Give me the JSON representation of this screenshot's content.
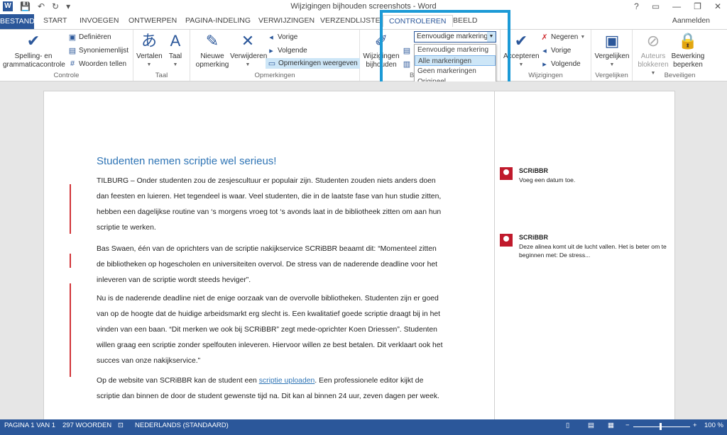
{
  "window": {
    "title": "Wijzigingen bijhouden screenshots - Word",
    "controls": [
      "?",
      "▭",
      "—",
      "❐",
      "✕"
    ]
  },
  "quick_access": [
    "save-icon",
    "undo-icon",
    "redo-icon",
    "customize-icon"
  ],
  "tabs": {
    "file": "BESTAND",
    "items": [
      "START",
      "INVOEGEN",
      "ONTWERPEN",
      "PAGINA-INDELING",
      "VERWIJZINGEN",
      "VERZENDLIJSTEN",
      "CONTROLEREN",
      "BEELD"
    ],
    "active": "CONTROLEREN",
    "signin": "Aanmelden"
  },
  "ribbon": {
    "controle": {
      "label": "Controle",
      "spelling": "Spelling- en grammaticacontrole",
      "define": "Definiëren",
      "thesaurus": "Synoniemenlijst",
      "wordcount": "Woorden tellen"
    },
    "taal": {
      "label": "Taal",
      "translate": "Vertalen",
      "language": "Taal"
    },
    "opmerkingen": {
      "label": "Opmerkingen",
      "new": "Nieuwe opmerking",
      "delete": "Verwijderen",
      "previous": "Vorige",
      "next": "Volgende",
      "show": "Opmerkingen weergeven"
    },
    "bijhouden": {
      "label": "B",
      "track": "Wijzigingen bijhouden",
      "track_line1": "Wijzigingen",
      "track_line2": "bijhouden",
      "markup_selected": "Eenvoudige markering",
      "markup_options": [
        "Eenvoudige markering",
        "Alle markeringen",
        "Geen markeringen",
        "Origineel"
      ],
      "markup_highlighted": "Alle markeringen"
    },
    "wijzigingen": {
      "label": "Wijzigingen",
      "accept": "Accepteren",
      "reject": "Negeren",
      "previous": "Vorige",
      "next": "Volgende"
    },
    "vergelijken": {
      "label": "Vergelijken",
      "compare": "Vergelijken"
    },
    "beveiligen": {
      "label": "Beveiligen",
      "block": "Auteurs blokkeren",
      "restrict": "Bewerking beperken"
    }
  },
  "document": {
    "heading": "Studenten nemen scriptie wel serieus!",
    "p1": "TILBURG – Onder studenten zou de zesjescultuur er populair zijn. Studenten zouden niets anders doen dan feesten en luieren. Het tegendeel is waar. Veel studenten, die in de laatste fase van hun studie zitten, hebben een dagelijkse routine van ‘s morgens vroeg tot ‘s avonds laat in de bibliotheek zitten om aan hun scriptie te werken.",
    "p2": "Bas Swaen, één van de oprichters van de scriptie nakijkservice SCRiBBR beaamt dit: “Momenteel zitten de bibliotheken op hogescholen en universiteiten overvol. De stress van de naderende deadline voor het inleveren van de scriptie wordt steeds heviger”.",
    "p3": "Nu is de naderende deadline niet de enige oorzaak van de overvolle bibliotheken. Studenten zijn er goed van op de hoogte dat de huidige arbeidsmarkt erg slecht is. Een kwalitatief goede scriptie draagt bij in het vinden van een baan. “Dit merken we ook bij SCRiBBR” zegt mede-oprichter Koen Driessen”. Studenten willen graag een scriptie zonder spelfouten inleveren. Hiervoor willen ze best betalen. Dit verklaart ook het succes van onze nakijkservice.”",
    "p4a": "Op de website van SCRiBBR kan de student een ",
    "p4link": "scriptie uploaden",
    "p4b": ". Een professionele editor kijkt de scriptie dan binnen de door de student gewenste tijd na. Dit kan al binnen 24 uur, zeven dagen per week."
  },
  "comments": [
    {
      "author": "SCRiBBR",
      "text": "Voeg een datum toe."
    },
    {
      "author": "SCRiBBR",
      "text": "Deze alinea komt uit de lucht vallen. Het is beter om te beginnen met: De stress..."
    }
  ],
  "status": {
    "page": "PAGINA 1 VAN 1",
    "words": "297 WOORDEN",
    "language": "NEDERLANDS (STANDAARD)",
    "zoom": "100 %",
    "zoom_level": 1.0
  },
  "colors": {
    "brand": "#2b579a",
    "heading": "#2e74b5",
    "changebar": "#d13438",
    "annotation_box": "#1c9ad6"
  }
}
